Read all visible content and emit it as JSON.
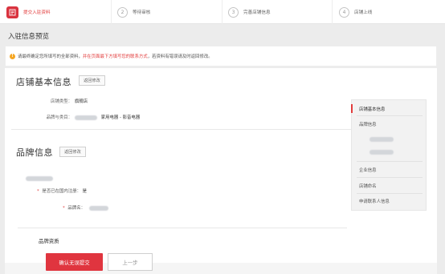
{
  "steps": [
    {
      "index": "",
      "label": "提交入驻资料",
      "active": true
    },
    {
      "index": "2",
      "label": "等待审核",
      "active": false
    },
    {
      "index": "3",
      "label": "完善店铺信息",
      "active": false
    },
    {
      "index": "4",
      "label": "店铺上线",
      "active": false
    }
  ],
  "page_title": "入驻信息预览",
  "notice": {
    "icon": "warning-icon",
    "before": "请最终确定您所填写的全部资料，",
    "highlight": "并在页面最下方填写您的联系方式",
    "after": "，若资料有错误请及时返回修改。"
  },
  "store_section": {
    "title": "店铺基本信息",
    "edit_label": "返回修改",
    "rows": [
      {
        "label": "店铺类型：",
        "value": "旗舰店"
      },
      {
        "label": "品牌与类目：",
        "value": "家用电器 - 影音电器"
      }
    ]
  },
  "brand_section": {
    "title": "品牌信息",
    "edit_label": "返回修改",
    "registered_label": "是否已在国内注册：",
    "registered_value": "是",
    "brand_name_label": "品牌名：",
    "qualification_title": "品牌资质"
  },
  "sidenav": {
    "items": [
      "店铺基本信息",
      "品牌信息",
      "企业信息",
      "店铺命名",
      "申请联系人信息"
    ]
  },
  "footer": {
    "confirm_label": "确认无误提交",
    "prev_label": "上一步"
  },
  "colors": {
    "accent": "#e23c3c",
    "button_red": "#e0353f"
  }
}
